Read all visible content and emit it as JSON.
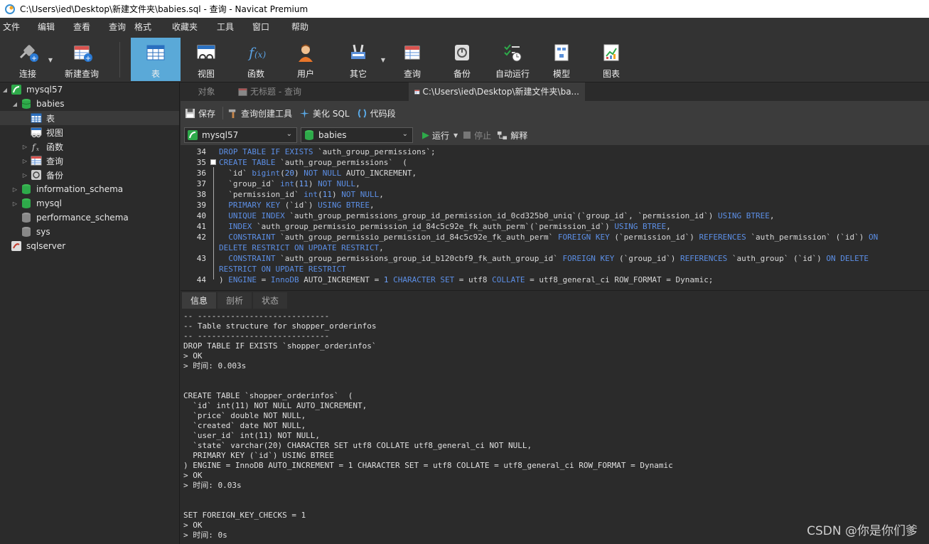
{
  "window": {
    "title": "C:\\Users\\ied\\Desktop\\新建文件夹\\babies.sql - 查询 - Navicat Premium"
  },
  "menu": [
    "文件",
    "编辑",
    "查看",
    "查询",
    "格式",
    "收藏夹",
    "工具",
    "窗口",
    "帮助"
  ],
  "toolbar": {
    "connect": "连接",
    "new_query": "新建查询",
    "table": "表",
    "view": "视图",
    "function": "函数",
    "user": "用户",
    "other": "其它",
    "query": "查询",
    "backup": "备份",
    "auto_run": "自动运行",
    "model": "模型",
    "chart": "图表"
  },
  "sidebar": {
    "mysql57": "mysql57",
    "babies": "babies",
    "tables": "表",
    "views": "视图",
    "functions": "函数",
    "queries": "查询",
    "backups": "备份",
    "information_schema": "information_schema",
    "mysql": "mysql",
    "performance_schema": "performance_schema",
    "sys": "sys",
    "sqlserver": "sqlserver"
  },
  "tabs": {
    "objects": "对象",
    "untitled": "无标题 - 查询",
    "file": "C:\\Users\\ied\\Desktop\\新建文件夹\\ba..."
  },
  "query_toolbar": {
    "save": "保存",
    "query_builder": "查询创建工具",
    "beautify": "美化 SQL",
    "snippet": "代码段"
  },
  "selectors": {
    "connection": "mysql57",
    "database": "babies",
    "run": "运行",
    "stop": "停止",
    "explain": "解释"
  },
  "editor": {
    "line_numbers": [
      "34",
      "35",
      "36",
      "37",
      "38",
      "39",
      "40",
      "41",
      "42",
      "",
      "43",
      "",
      "44"
    ]
  },
  "bottom_tabs": [
    "信息",
    "剖析",
    "状态"
  ],
  "output_lines": [
    "-- ----------------------------",
    "-- Table structure for shopper_orderinfos",
    "-- ----------------------------",
    "DROP TABLE IF EXISTS `shopper_orderinfos`",
    "> OK",
    "> 时间: 0.003s",
    "",
    "",
    "CREATE TABLE `shopper_orderinfos`  (",
    "  `id` int(11) NOT NULL AUTO_INCREMENT,",
    "  `price` double NOT NULL,",
    "  `created` date NOT NULL,",
    "  `user_id` int(11) NOT NULL,",
    "  `state` varchar(20) CHARACTER SET utf8 COLLATE utf8_general_ci NOT NULL,",
    "  PRIMARY KEY (`id`) USING BTREE",
    ") ENGINE = InnoDB AUTO_INCREMENT = 1 CHARACTER SET = utf8 COLLATE = utf8_general_ci ROW_FORMAT = Dynamic",
    "> OK",
    "> 时间: 0.03s",
    "",
    "",
    "SET FOREIGN_KEY_CHECKS = 1",
    "> OK",
    "> 时间: 0s"
  ],
  "watermark": "CSDN @你是你们爹"
}
